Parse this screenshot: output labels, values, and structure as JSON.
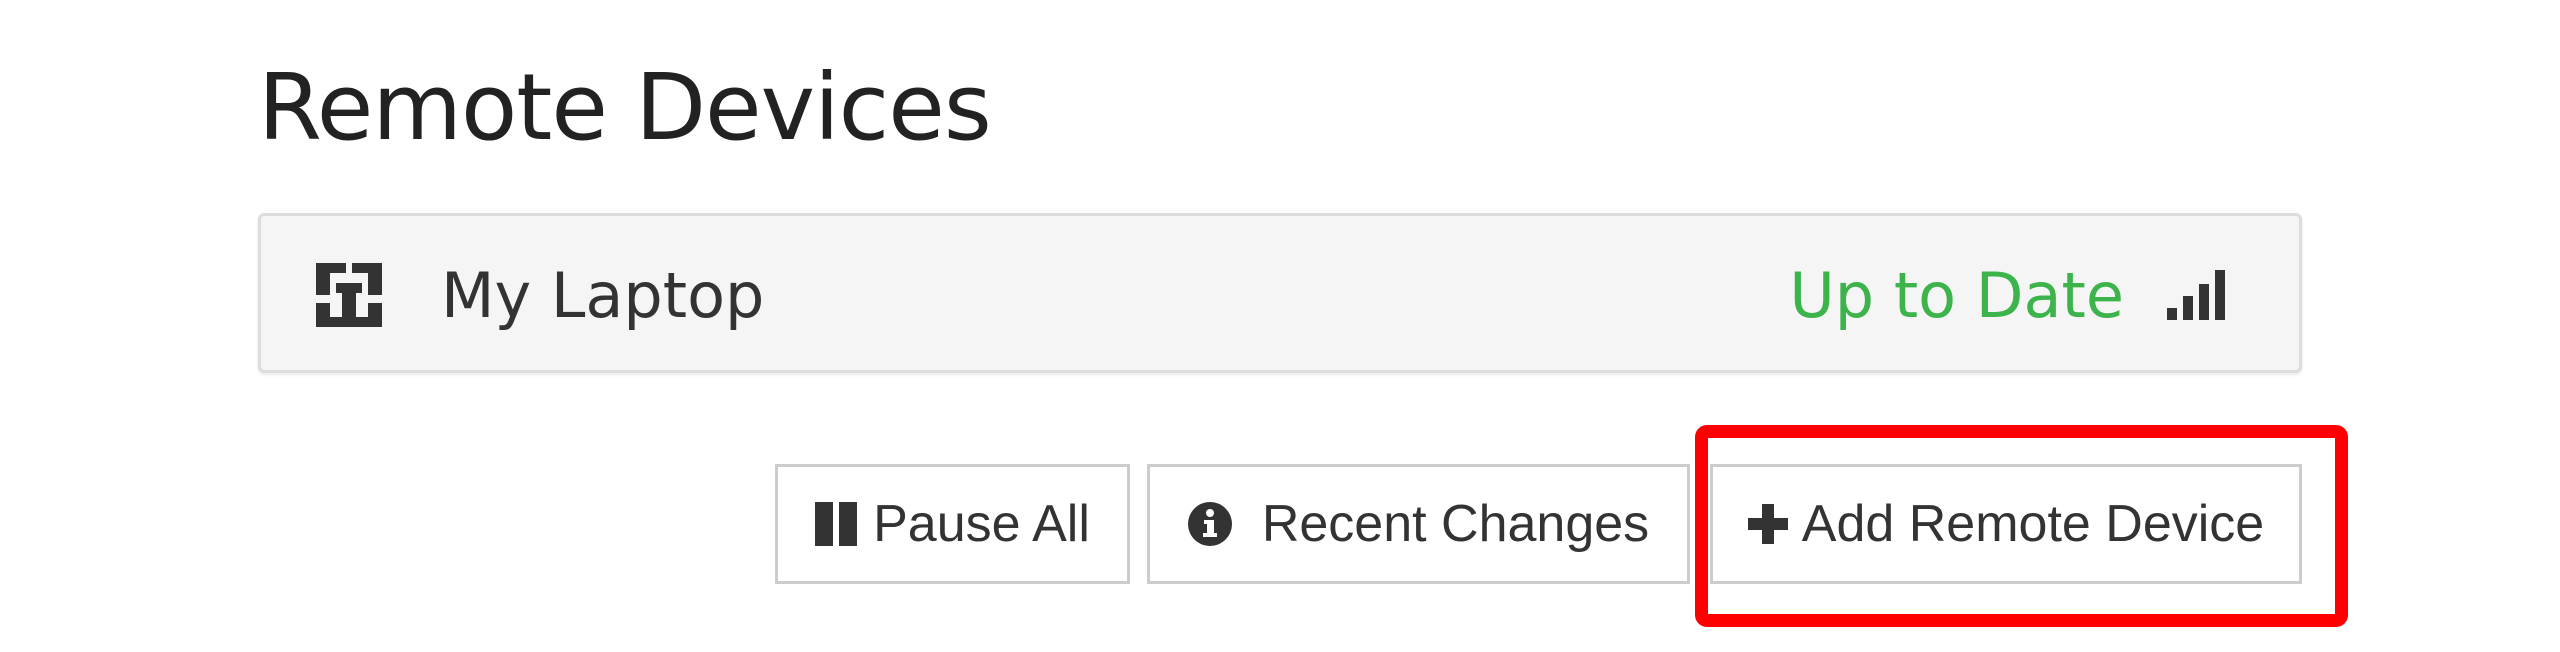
{
  "page": {
    "title": "Remote Devices"
  },
  "devices": [
    {
      "name": "My Laptop",
      "status": "Up to Date",
      "icon": "device-logo-icon",
      "signal_icon": "signal-bars-icon",
      "status_color": "#3cb44b"
    }
  ],
  "actions": {
    "pause_all": {
      "label": "Pause All",
      "icon": "pause-icon"
    },
    "recent_changes": {
      "label": "Recent Changes",
      "icon": "info-circle-icon"
    },
    "add_remote_device": {
      "label": "Add Remote Device",
      "icon": "plus-icon"
    }
  },
  "annotation": {
    "highlight_color": "#ff0000",
    "highlighted_element": "add-remote-device-button"
  }
}
